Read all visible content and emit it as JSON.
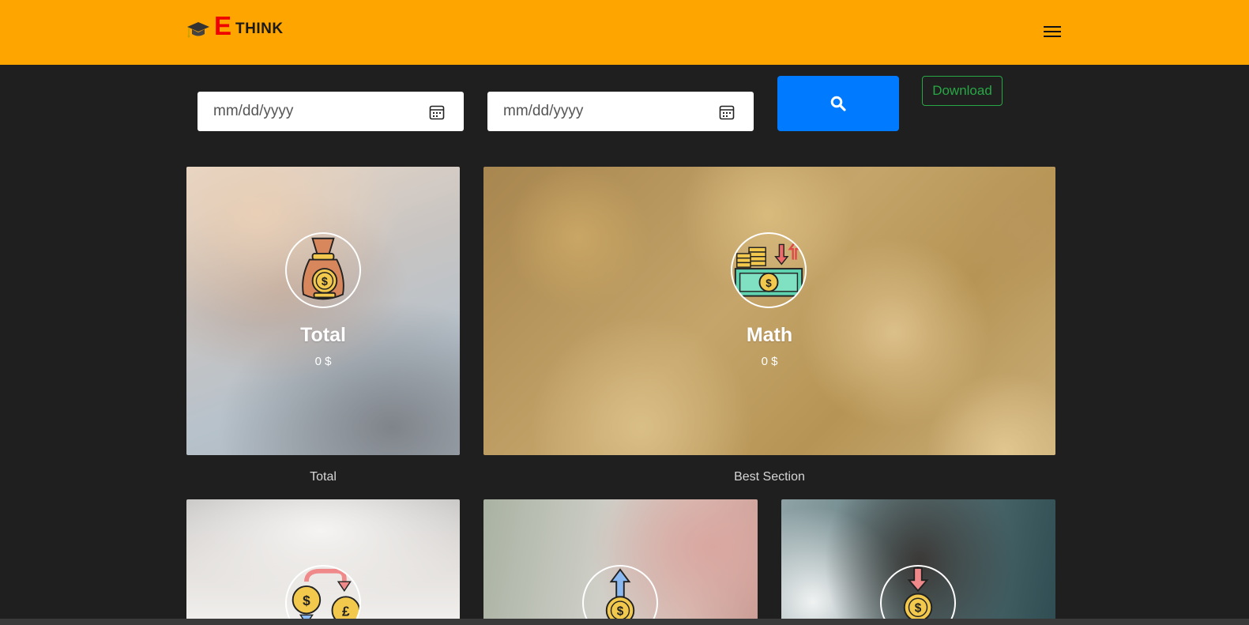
{
  "header": {
    "brand_letter": "E",
    "brand_text": "THINK",
    "logo_icon": "graduation-cap-icon",
    "menu_icon": "hamburger-menu-icon",
    "background_color": "#ffa500"
  },
  "filters": {
    "start_date_placeholder": "mm/dd/yyyy",
    "end_date_placeholder": "mm/dd/yyyy",
    "calendar_icon": "calendar-icon",
    "search_icon": "search-icon",
    "search_button_color": "#007bff",
    "download_label": "Download",
    "download_color": "#28a745"
  },
  "cards": [
    {
      "title": "Total",
      "value": "0 $",
      "caption": "Total",
      "icon": "money-bag-icon"
    },
    {
      "title": "Math",
      "value": "0 $",
      "caption": "Best Section",
      "icon": "cash-coins-icon"
    },
    {
      "icon": "currency-exchange-icon"
    },
    {
      "icon": "income-arrow-up-icon"
    },
    {
      "icon": "expense-arrow-down-icon"
    }
  ]
}
